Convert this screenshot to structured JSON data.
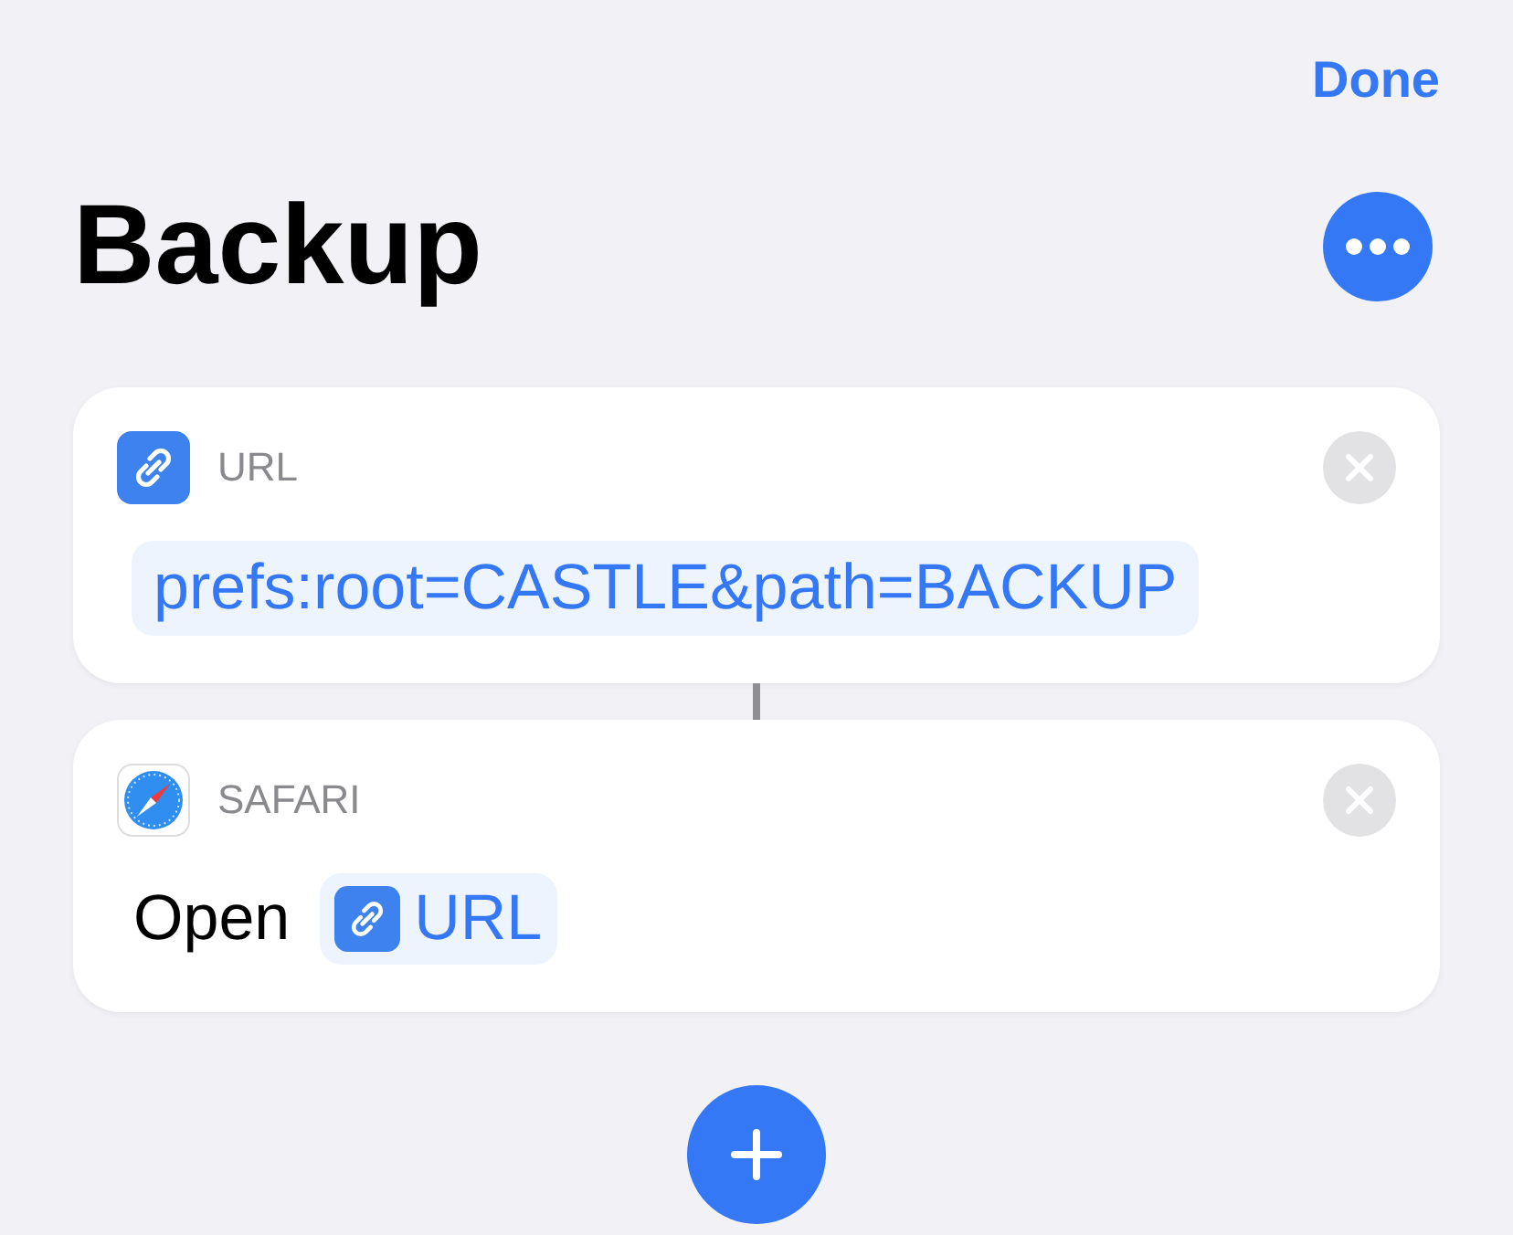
{
  "nav": {
    "done_label": "Done"
  },
  "title": "Backup",
  "actions": [
    {
      "kind": "url",
      "app_label": "URL",
      "value": "prefs:root=CASTLE&path=BACKUP"
    },
    {
      "kind": "safari",
      "app_label": "SAFARI",
      "verb": "Open",
      "variable": "URL"
    }
  ]
}
